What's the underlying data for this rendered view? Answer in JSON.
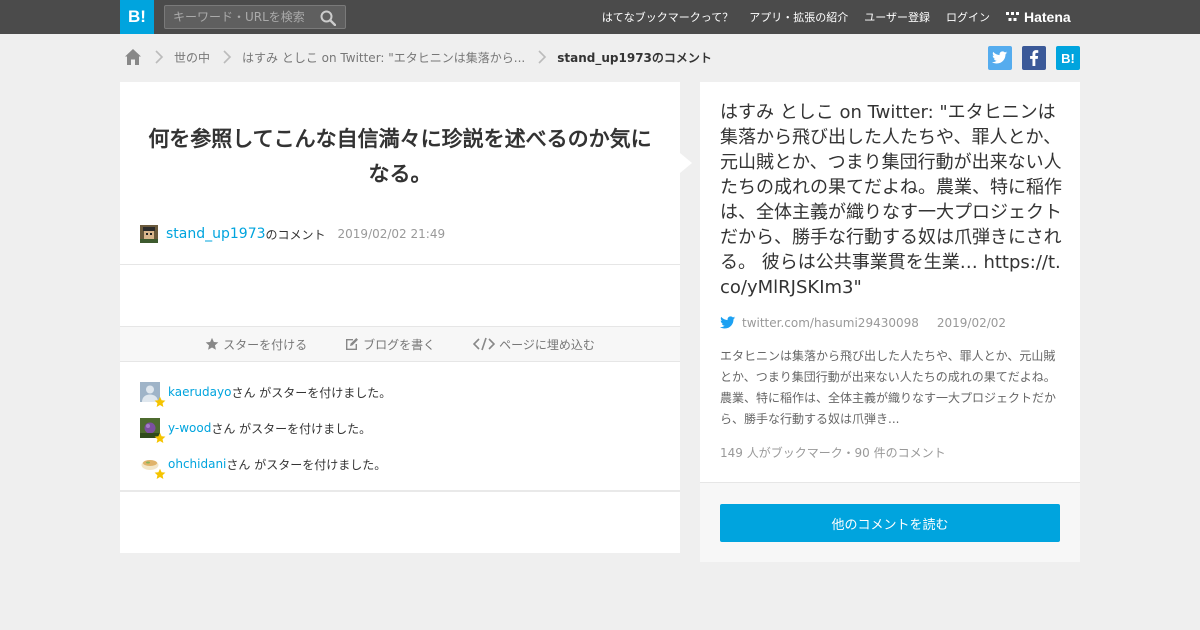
{
  "header": {
    "logo": "B!",
    "search_placeholder": "キーワード・URLを検索",
    "nav": [
      {
        "label": "はてなブックマークって？"
      },
      {
        "label": "アプリ・拡張の紹介"
      },
      {
        "label": "ユーザー登録"
      },
      {
        "label": "ログイン"
      }
    ],
    "brand": "Hatena"
  },
  "breadcrumb": {
    "items": [
      {
        "label": "世の中"
      },
      {
        "label": "はすみ としこ on Twitter: \"エタヒニンは集落から..."
      }
    ],
    "current": "stand_up1973のコメント"
  },
  "share": {
    "twitter_color": "#55acee",
    "facebook_color": "#3b5998",
    "hatena_color": "#00a4de",
    "hatena_label": "B!"
  },
  "comment": {
    "text": "何を参照してこんな自信満々に珍説を述べるのか気になる。",
    "user": "stand_up1973",
    "user_suffix": "のコメント",
    "date": "2019/02/02 21:49"
  },
  "actions": [
    {
      "label": "スターを付ける"
    },
    {
      "label": "ブログを書く"
    },
    {
      "label": "ページに埋め込む"
    }
  ],
  "stars": [
    {
      "user": "kaerudayo",
      "text": "さん がスターを付けました。"
    },
    {
      "user": "y-wood",
      "text": "さん がスターを付けました。"
    },
    {
      "user": "ohchidani",
      "text": "さん がスターを付けました。"
    }
  ],
  "entry": {
    "title": "はすみ としこ on Twitter: \"エタヒニンは集落から飛び出した人たちや、罪人とか、元山賊とか、つまり集団行動が出来ない人たちの成れの果てだよね。農業、特に稲作は、全体主義が織りなす一大プロジェクトだから、勝手な行動する奴は爪弾きにされる。 彼らは公共事業貫を生業… https://t.co/yMlRJSKIm3\"",
    "source": "twitter.com/hasumi29430098",
    "date": "2019/02/02",
    "summary": "エタヒニンは集落から飛び出した人たちや、罪人とか、元山賊とか、つまり集団行動が出来ない人たちの成れの果てだよね。農業、特に稲作は、全体主義が織りなす一大プロジェクトだから、勝手な行動する奴は爪弾き...",
    "counts": "149 人がブックマーク・90 件のコメント",
    "read_button": "他のコメントを読む"
  },
  "colors": {
    "accent": "#00a4de",
    "header_bg": "#4b4b4b",
    "page_bg": "#efefef",
    "star": "#f5c400"
  }
}
